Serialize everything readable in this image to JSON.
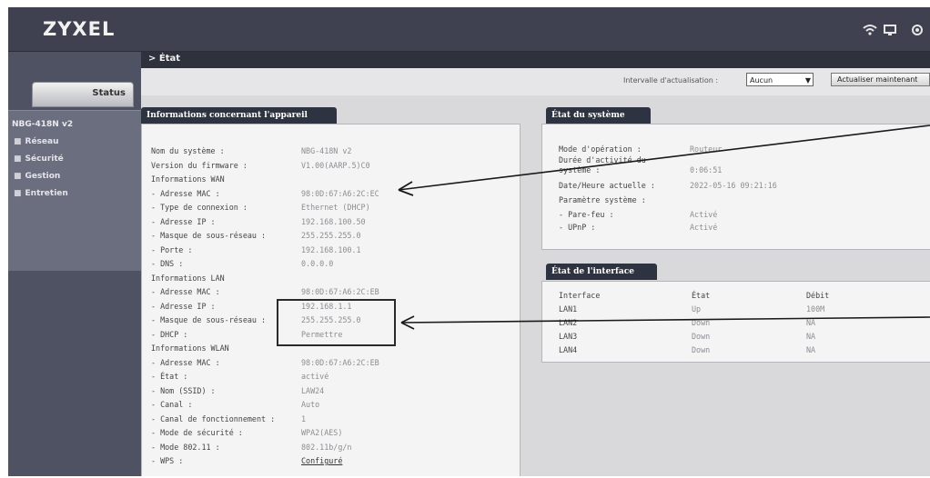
{
  "header": {
    "logo": "ZYXEL",
    "icons": [
      "wifi-icon",
      "monitor-icon",
      "network-icon"
    ]
  },
  "sidebar": {
    "status_tab": "Status",
    "tree_title": "NBG-418N v2",
    "items": [
      {
        "label": "Réseau",
        "icon": "plus-icon"
      },
      {
        "label": "Sécurité",
        "icon": "plus-icon"
      },
      {
        "label": "Gestion",
        "icon": "plus-icon"
      },
      {
        "label": "Entretien",
        "icon": "plus-icon"
      }
    ]
  },
  "breadcrumb": "> État",
  "refresh": {
    "label": "Intervalle d'actualisation :",
    "selected": "Aucun",
    "button": "Actualiser maintenant"
  },
  "device_info": {
    "title": "Informations concernant l'appareil",
    "rows": [
      {
        "label": "Nom du système :",
        "value": "NBG-418N v2"
      },
      {
        "label": "Version du firmware :",
        "value": "V1.00(AARP.5)C0"
      },
      {
        "label": "Informations WAN",
        "value": ""
      },
      {
        "label": " - Adresse MAC :",
        "value": "98:0D:67:A6:2C:EC"
      },
      {
        "label": " - Type de connexion :",
        "value": "Ethernet (DHCP)"
      },
      {
        "label": " - Adresse IP :",
        "value": "192.168.100.50"
      },
      {
        "label": " - Masque de sous-réseau :",
        "value": "255.255.255.0"
      },
      {
        "label": " - Porte :",
        "value": "192.168.100.1"
      },
      {
        "label": " - DNS :",
        "value": "0.0.0.0"
      },
      {
        "label": "Informations LAN",
        "value": ""
      },
      {
        "label": " - Adresse MAC :",
        "value": "98:0D:67:A6:2C:EB"
      },
      {
        "label": " - Adresse IP :",
        "value": "192.168.1.1"
      },
      {
        "label": " - Masque de sous-réseau :",
        "value": "255.255.255.0"
      },
      {
        "label": " - DHCP :",
        "value": "Permettre"
      },
      {
        "label": "Informations WLAN",
        "value": ""
      },
      {
        "label": " - Adresse MAC :",
        "value": "98:0D:67:A6:2C:EB"
      },
      {
        "label": " - État :",
        "value": "activé"
      },
      {
        "label": " - Nom (SSID) :",
        "value": "LAW24"
      },
      {
        "label": " - Canal :",
        "value": "Auto"
      },
      {
        "label": " - Canal de fonctionnement :",
        "value": "1"
      },
      {
        "label": " - Mode de sécurité :",
        "value": "WPA2(AES)"
      },
      {
        "label": " - Mode 802.11 :",
        "value": "802.11b/g/n"
      },
      {
        "label": " - WPS :",
        "value": "Configuré"
      }
    ]
  },
  "system_status": {
    "title": "État du système",
    "rows": [
      {
        "label": "Mode d'opération :",
        "value": "Routeur"
      },
      {
        "label": "Durée d'activité du",
        "value": ""
      },
      {
        "label": "système :",
        "value": "0:06:51"
      },
      {
        "label": "Date/Heure actuelle :",
        "value": "2022-05-16 09:21:16"
      },
      {
        "label": "Paramètre système :",
        "value": ""
      },
      {
        "label": " - Pare-feu :",
        "value": "Activé"
      },
      {
        "label": " - UPnP :",
        "value": "Activé"
      }
    ]
  },
  "interface_status": {
    "title": "État de l'interface",
    "headers": [
      "Interface",
      "État",
      "Débit"
    ],
    "rows": [
      [
        "LAN1",
        "Up",
        "100M"
      ],
      [
        "LAN2",
        "Down",
        "NA"
      ],
      [
        "LAN3",
        "Down",
        "NA"
      ],
      [
        "LAN4",
        "Down",
        "NA"
      ]
    ]
  }
}
